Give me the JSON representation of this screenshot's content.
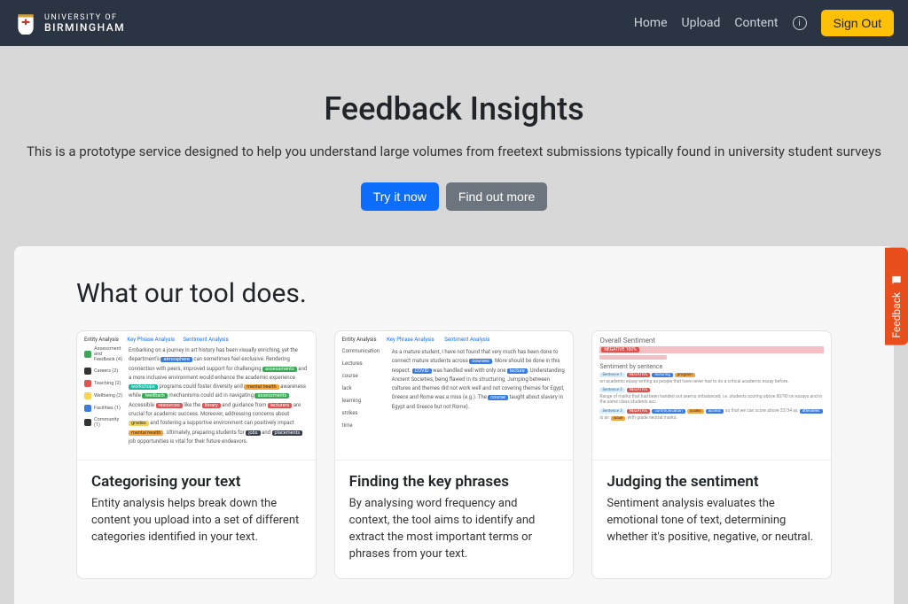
{
  "navbar": {
    "brand_top": "UNIVERSITY OF",
    "brand_bottom": "BIRMINGHAM",
    "links": {
      "home": "Home",
      "upload": "Upload",
      "content": "Content"
    },
    "signout": "Sign Out"
  },
  "hero": {
    "title": "Feedback Insights",
    "subtitle": "This is a prototype service designed to help you understand large volumes from freetext submissions typically found in university student surveys",
    "try_btn": "Try it now",
    "more_btn": "Find out more"
  },
  "section": {
    "heading": "What our tool does."
  },
  "cards": [
    {
      "title": "Categorising your text",
      "text": "Entity analysis helps break down the content you upload into a set of different categories identified in your text.",
      "tabs": {
        "a": "Entity Analysis",
        "b": "Key Phrase Analysis",
        "c": "Sentiment Analysis"
      },
      "side": [
        {
          "color": "#3aa856",
          "label": "Assessment and Feedback (4)"
        },
        {
          "color": "#333",
          "label": "Careers (2)"
        },
        {
          "color": "#e15454",
          "label": "Teaching (2)"
        },
        {
          "color": "#f7d552",
          "label": "Wellbeing (2)"
        },
        {
          "color": "#3b7cde",
          "label": "Facilities (1)"
        },
        {
          "color": "#333",
          "label": "Community (1)"
        }
      ]
    },
    {
      "title": "Finding the key phrases",
      "text": "By analysing word frequency and context, the tool aims to identify and extract the most important terms or phrases from your text.",
      "tabs": {
        "a": "Entity Analysis",
        "b": "Key Phrase Analysis",
        "c": "Sentiment Analysis"
      },
      "side": [
        "Communication",
        "Lectures",
        "course",
        "lack",
        "learning",
        "strikes",
        "time"
      ]
    },
    {
      "title": "Judging the sentiment",
      "text": "Sentiment analysis evaluates the emotional tone of text, determining whether it's positive, negative, or neutral.",
      "overall": "Overall Sentiment",
      "neg_label": "NEGATIVE 100%",
      "by_sentence": "Sentiment by sentence"
    }
  ],
  "feedback_tab": "Feedback"
}
